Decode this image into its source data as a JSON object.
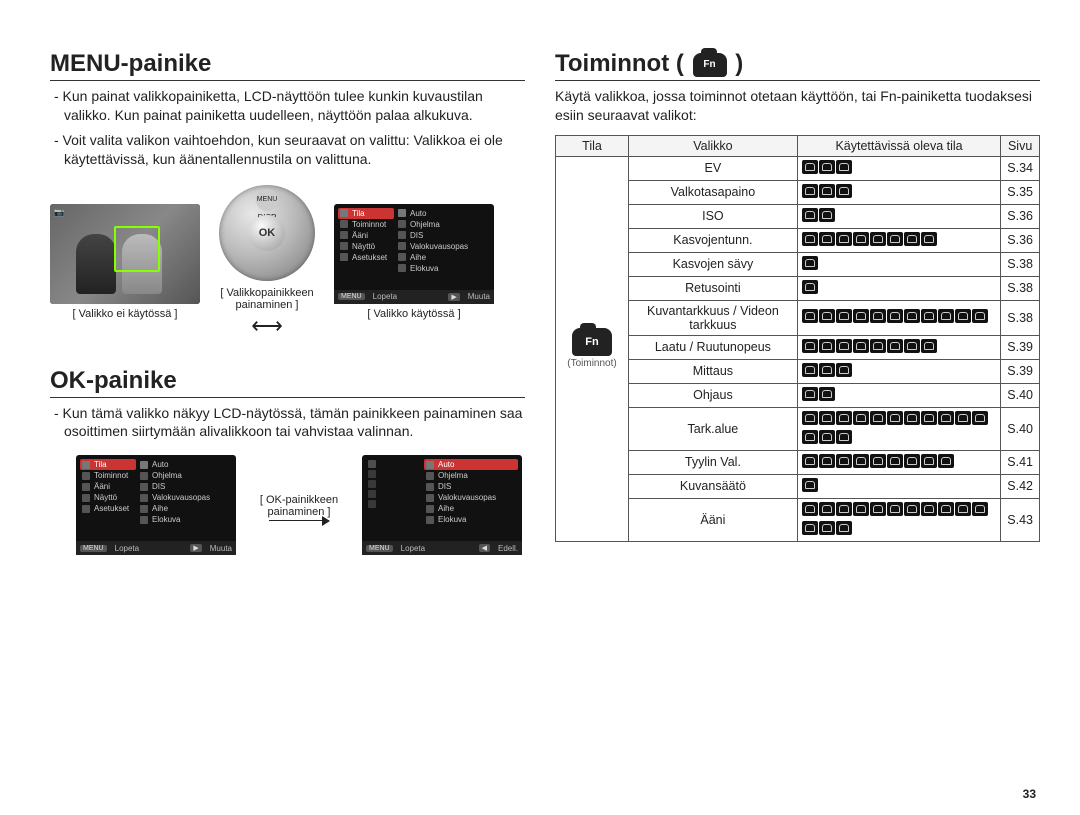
{
  "page_number": "33",
  "left": {
    "h1": "MENU-painike",
    "p1": "- Kun painat valikkopainiketta, LCD-näyttöön tulee kunkin kuvaustilan valikko. Kun painat painiketta uudelleen, näyttöön palaa alkukuva.",
    "p2": "- Voit valita valikon vaihtoehdon, kun seuraavat on valittu: Valikkoa ei ole käytettävissä, kun äänentallennustila on valittuna.",
    "fig1": {
      "cap_left": "Valikko ei käytössä",
      "cap_mid": "Valikkopainikkeen painaminen",
      "cap_right": "Valikko käytössä",
      "wheel_ok": "OK",
      "wheel_menu": "MENU",
      "wheel_disp": "DISP",
      "menu_items_left": [
        "Tila",
        "Toiminnot",
        "Ääni",
        "Näyttö",
        "Asetukset"
      ],
      "menu_items_right": [
        "Auto",
        "Ohjelma",
        "DIS",
        "Valokuvausopas",
        "Aihe",
        "Elokuva"
      ],
      "bar_left": "Lopeta",
      "bar_right": "Muuta"
    },
    "h2": "OK-painike",
    "p3": "- Kun tämä valikko näkyy LCD-näytössä, tämän painikkeen painaminen saa osoittimen siirtymään alivalikkoon tai vahvistaa valinnan.",
    "fig2": {
      "cap_mid": "OK-painikkeen painaminen",
      "bar2_right": "Edell."
    }
  },
  "right": {
    "h1": "Toiminnot (",
    "h1_after": ")",
    "fn_label": "Fn",
    "p1": "Käytä valikkoa, jossa toiminnot otetaan käyttöön, tai Fn-painiketta tuodaksesi esiin seuraavat valikot:",
    "table": {
      "headers": [
        "Tila",
        "Valikko",
        "Käytettävissä oleva tila",
        "Sivu"
      ],
      "mode_label": "Toiminnot",
      "rows": [
        {
          "menu": "EV",
          "icons": 3,
          "page": "S.34"
        },
        {
          "menu": "Valkotasapaino",
          "icons": 3,
          "page": "S.35"
        },
        {
          "menu": "ISO",
          "icons": 2,
          "page": "S.36"
        },
        {
          "menu": "Kasvojentunn.",
          "icons": 8,
          "page": "S.36"
        },
        {
          "menu": "Kasvojen sävy",
          "icons": 1,
          "page": "S.38"
        },
        {
          "menu": "Retusointi",
          "icons": 1,
          "page": "S.38"
        },
        {
          "menu": "Kuvantarkkuus / Videon tarkkuus",
          "icons": 11,
          "page": "S.38"
        },
        {
          "menu": "Laatu / Ruutunopeus",
          "icons": 8,
          "page": "S.39"
        },
        {
          "menu": "Mittaus",
          "icons": 3,
          "page": "S.39"
        },
        {
          "menu": "Ohjaus",
          "icons": 2,
          "page": "S.40"
        },
        {
          "menu": "Tark.alue",
          "icons": 14,
          "page": "S.40"
        },
        {
          "menu": "Tyylin Val.",
          "icons": 9,
          "page": "S.41"
        },
        {
          "menu": "Kuvansäätö",
          "icons": 1,
          "page": "S.42"
        },
        {
          "menu": "Ääni",
          "icons": 14,
          "page": "S.43"
        }
      ]
    }
  }
}
